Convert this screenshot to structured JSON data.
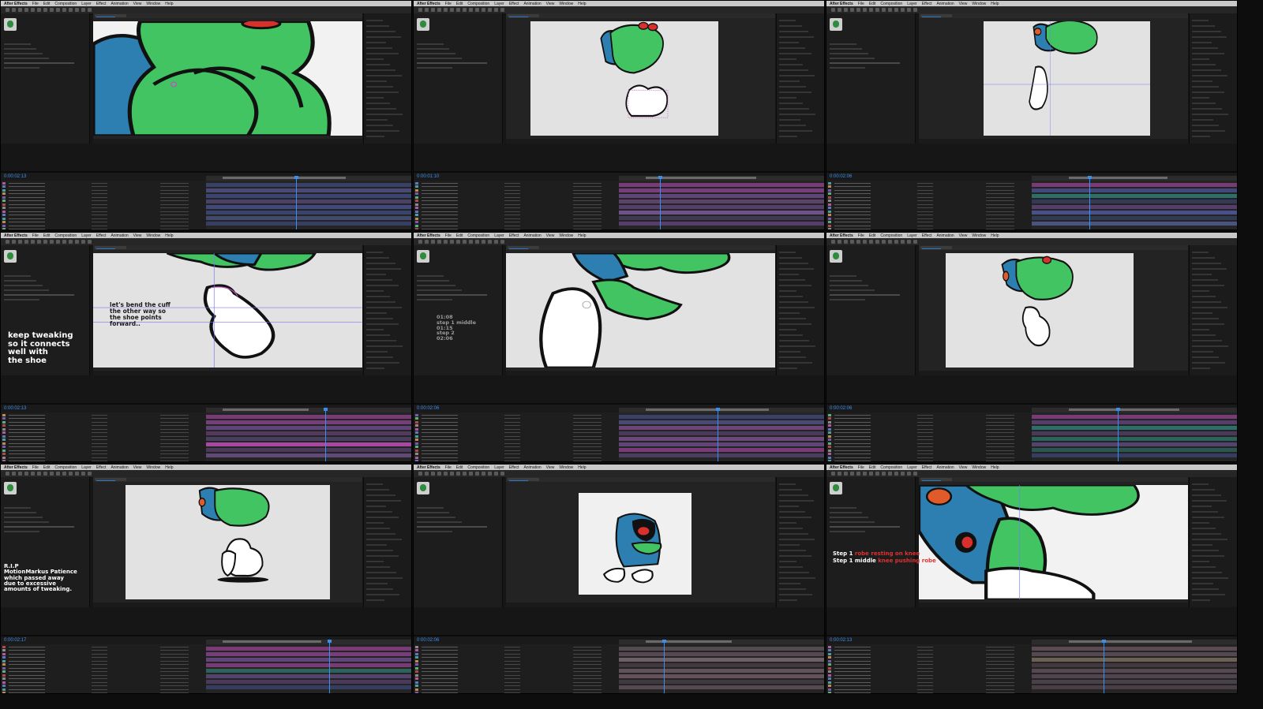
{
  "menubar": {
    "app": "After Effects",
    "items": [
      "File",
      "Edit",
      "Composition",
      "Layer",
      "Effect",
      "Animation",
      "View",
      "Window",
      "Help"
    ]
  },
  "annotations": {
    "p4_viewer": "let's bend the cuff\nthe other way so\nthe shoe points\nforward..",
    "p4_left": "keep tweaking\nso it connects\nwell with\nthe shoe",
    "p5_left": "01:08\nstep 1 middle\n01:15\nstep 2\n02:06",
    "p7_left": "R.I.P\nMotionMarkus Patience\nwhich passed away\ndue to excessive\namounts of tweaking.",
    "p9_lines": [
      {
        "label": "Step 1",
        "note": "robe resting on knee"
      },
      {
        "label": "Step 1 middle",
        "note": "knee pushing robe"
      }
    ]
  },
  "timecodes": [
    "0:00:02:13",
    "0:00:01:10",
    "0:00:02:06",
    "0:00:02:13",
    "0:00:02:06",
    "0:00:02:06",
    "0:00:02:17",
    "0:00:02:06",
    "0:00:02:13"
  ],
  "colors": {
    "character_green": "#43c463",
    "robe_blue": "#2c7fb0",
    "outline": "#111111",
    "eye_red": "#d8302c",
    "track_purple": "#6b4a8a",
    "track_magenta": "#c04fb8",
    "track_blue": "#4d5a9e",
    "track_teal": "#2f7d74",
    "playhead": "#3a8ef2",
    "timecode": "#3b8ff0"
  }
}
